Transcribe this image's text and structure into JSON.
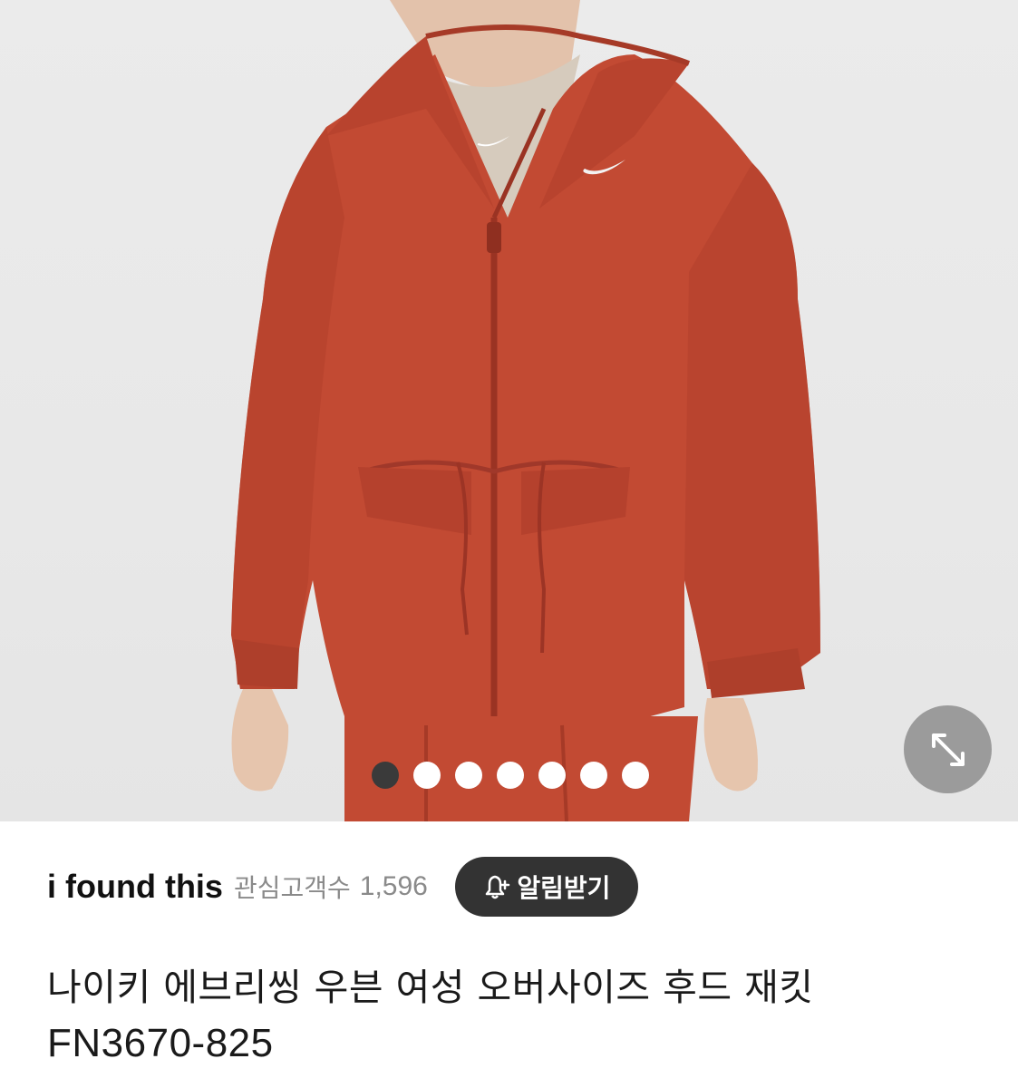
{
  "product": {
    "image_alt": "Nike woven oversized hooded jacket",
    "image_index": 1,
    "image_count": 7,
    "title_line1": "나이키 에브리씽 우븐 여성 오버사이즈 후드 재킷",
    "title_line2": "FN3670-825"
  },
  "seller": {
    "name": "i found this",
    "fans_label": "관심고객수",
    "fans_count": "1,596",
    "follow_label": "알림받기",
    "follow_icon": "bell-plus-icon"
  },
  "controls": {
    "expand_icon": "expand-arrows-icon"
  },
  "colors": {
    "jacket": "#C24A33",
    "button_dark": "#333333",
    "expand_bg": "#9B9B9B"
  }
}
